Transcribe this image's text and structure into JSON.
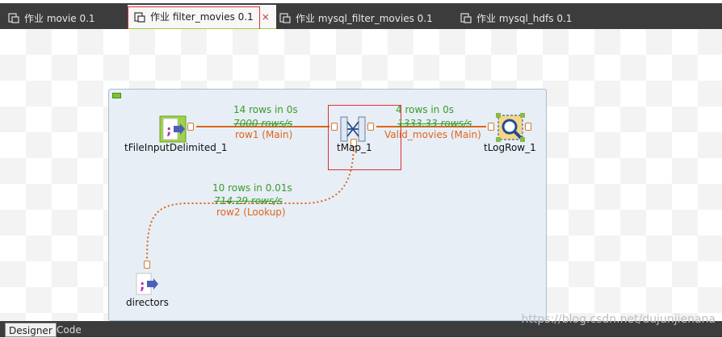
{
  "tabs": [
    {
      "label": "作业 movie 0.1"
    },
    {
      "label": "作业 filter_movies 0.1"
    },
    {
      "label": "作业 mysql_filter_movies 0.1"
    },
    {
      "label": "作业 mysql_hdfs 0.1"
    }
  ],
  "close_glyph": "×",
  "components": {
    "input": "tFileInputDelimited_1",
    "map": "tMap_1",
    "log": "tLogRow_1",
    "directors": "directors"
  },
  "links": {
    "row1": {
      "stat": "14 rows in 0s",
      "rate": "7000 rows/s",
      "label": "row1 (Main)"
    },
    "valid": {
      "stat": "4 rows in 0s",
      "rate": "1333.33 rows/s",
      "label": "Valid_movies (Main)"
    },
    "row2": {
      "stat": "10 rows in 0.01s",
      "rate": "714.29 rows/s",
      "label": "row2 (Lookup)"
    }
  },
  "bottom_tabs": {
    "designer": "Designer",
    "code": "Code"
  },
  "watermark": "https://blog.csdn.net/dujunjienana",
  "colors": {
    "link": "#e0651a",
    "stat": "#3a9a2a",
    "highlight": "#e03030",
    "subjob_bg": "#e7eef6"
  }
}
